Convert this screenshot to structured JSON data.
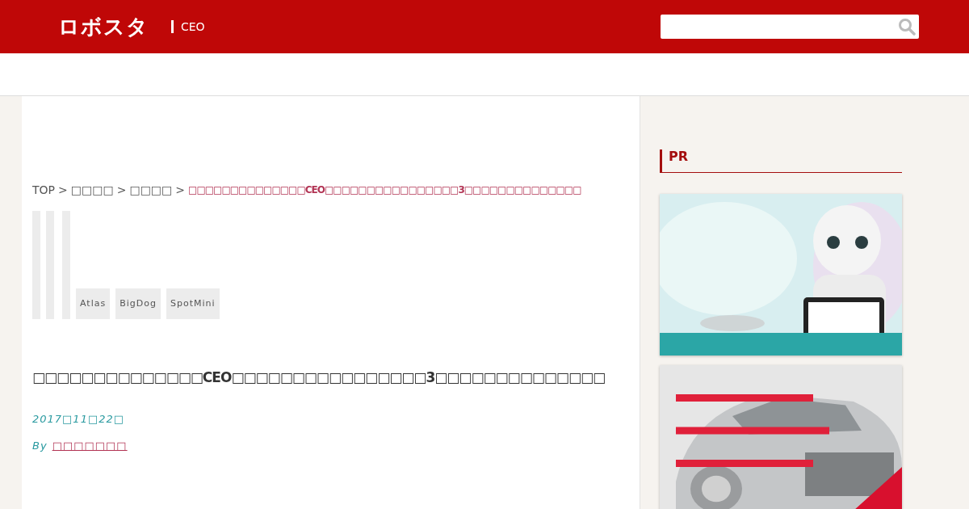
{
  "header": {
    "logo": "ロボスタ",
    "section": "CEO"
  },
  "breadcrumb": {
    "items": [
      "TOP",
      "□□□□",
      "□□□□"
    ],
    "separator": ">",
    "current": "□□□□□□□□□□□□□□CEO□□□□□□□□□□□□□□□□3□□□□□□□□□□□□□□"
  },
  "tags": [
    "Atlas",
    "BigDog",
    "SpotMini"
  ],
  "article": {
    "title": "□□□□□□□□□□□□□□CEO□□□□□□□□□□□□□□□□3□□□□□□□□□□□□□□",
    "date": "2017□11□22□",
    "by": "By",
    "author": "□□□□□□□"
  },
  "sidebar": {
    "heading": "PR"
  }
}
